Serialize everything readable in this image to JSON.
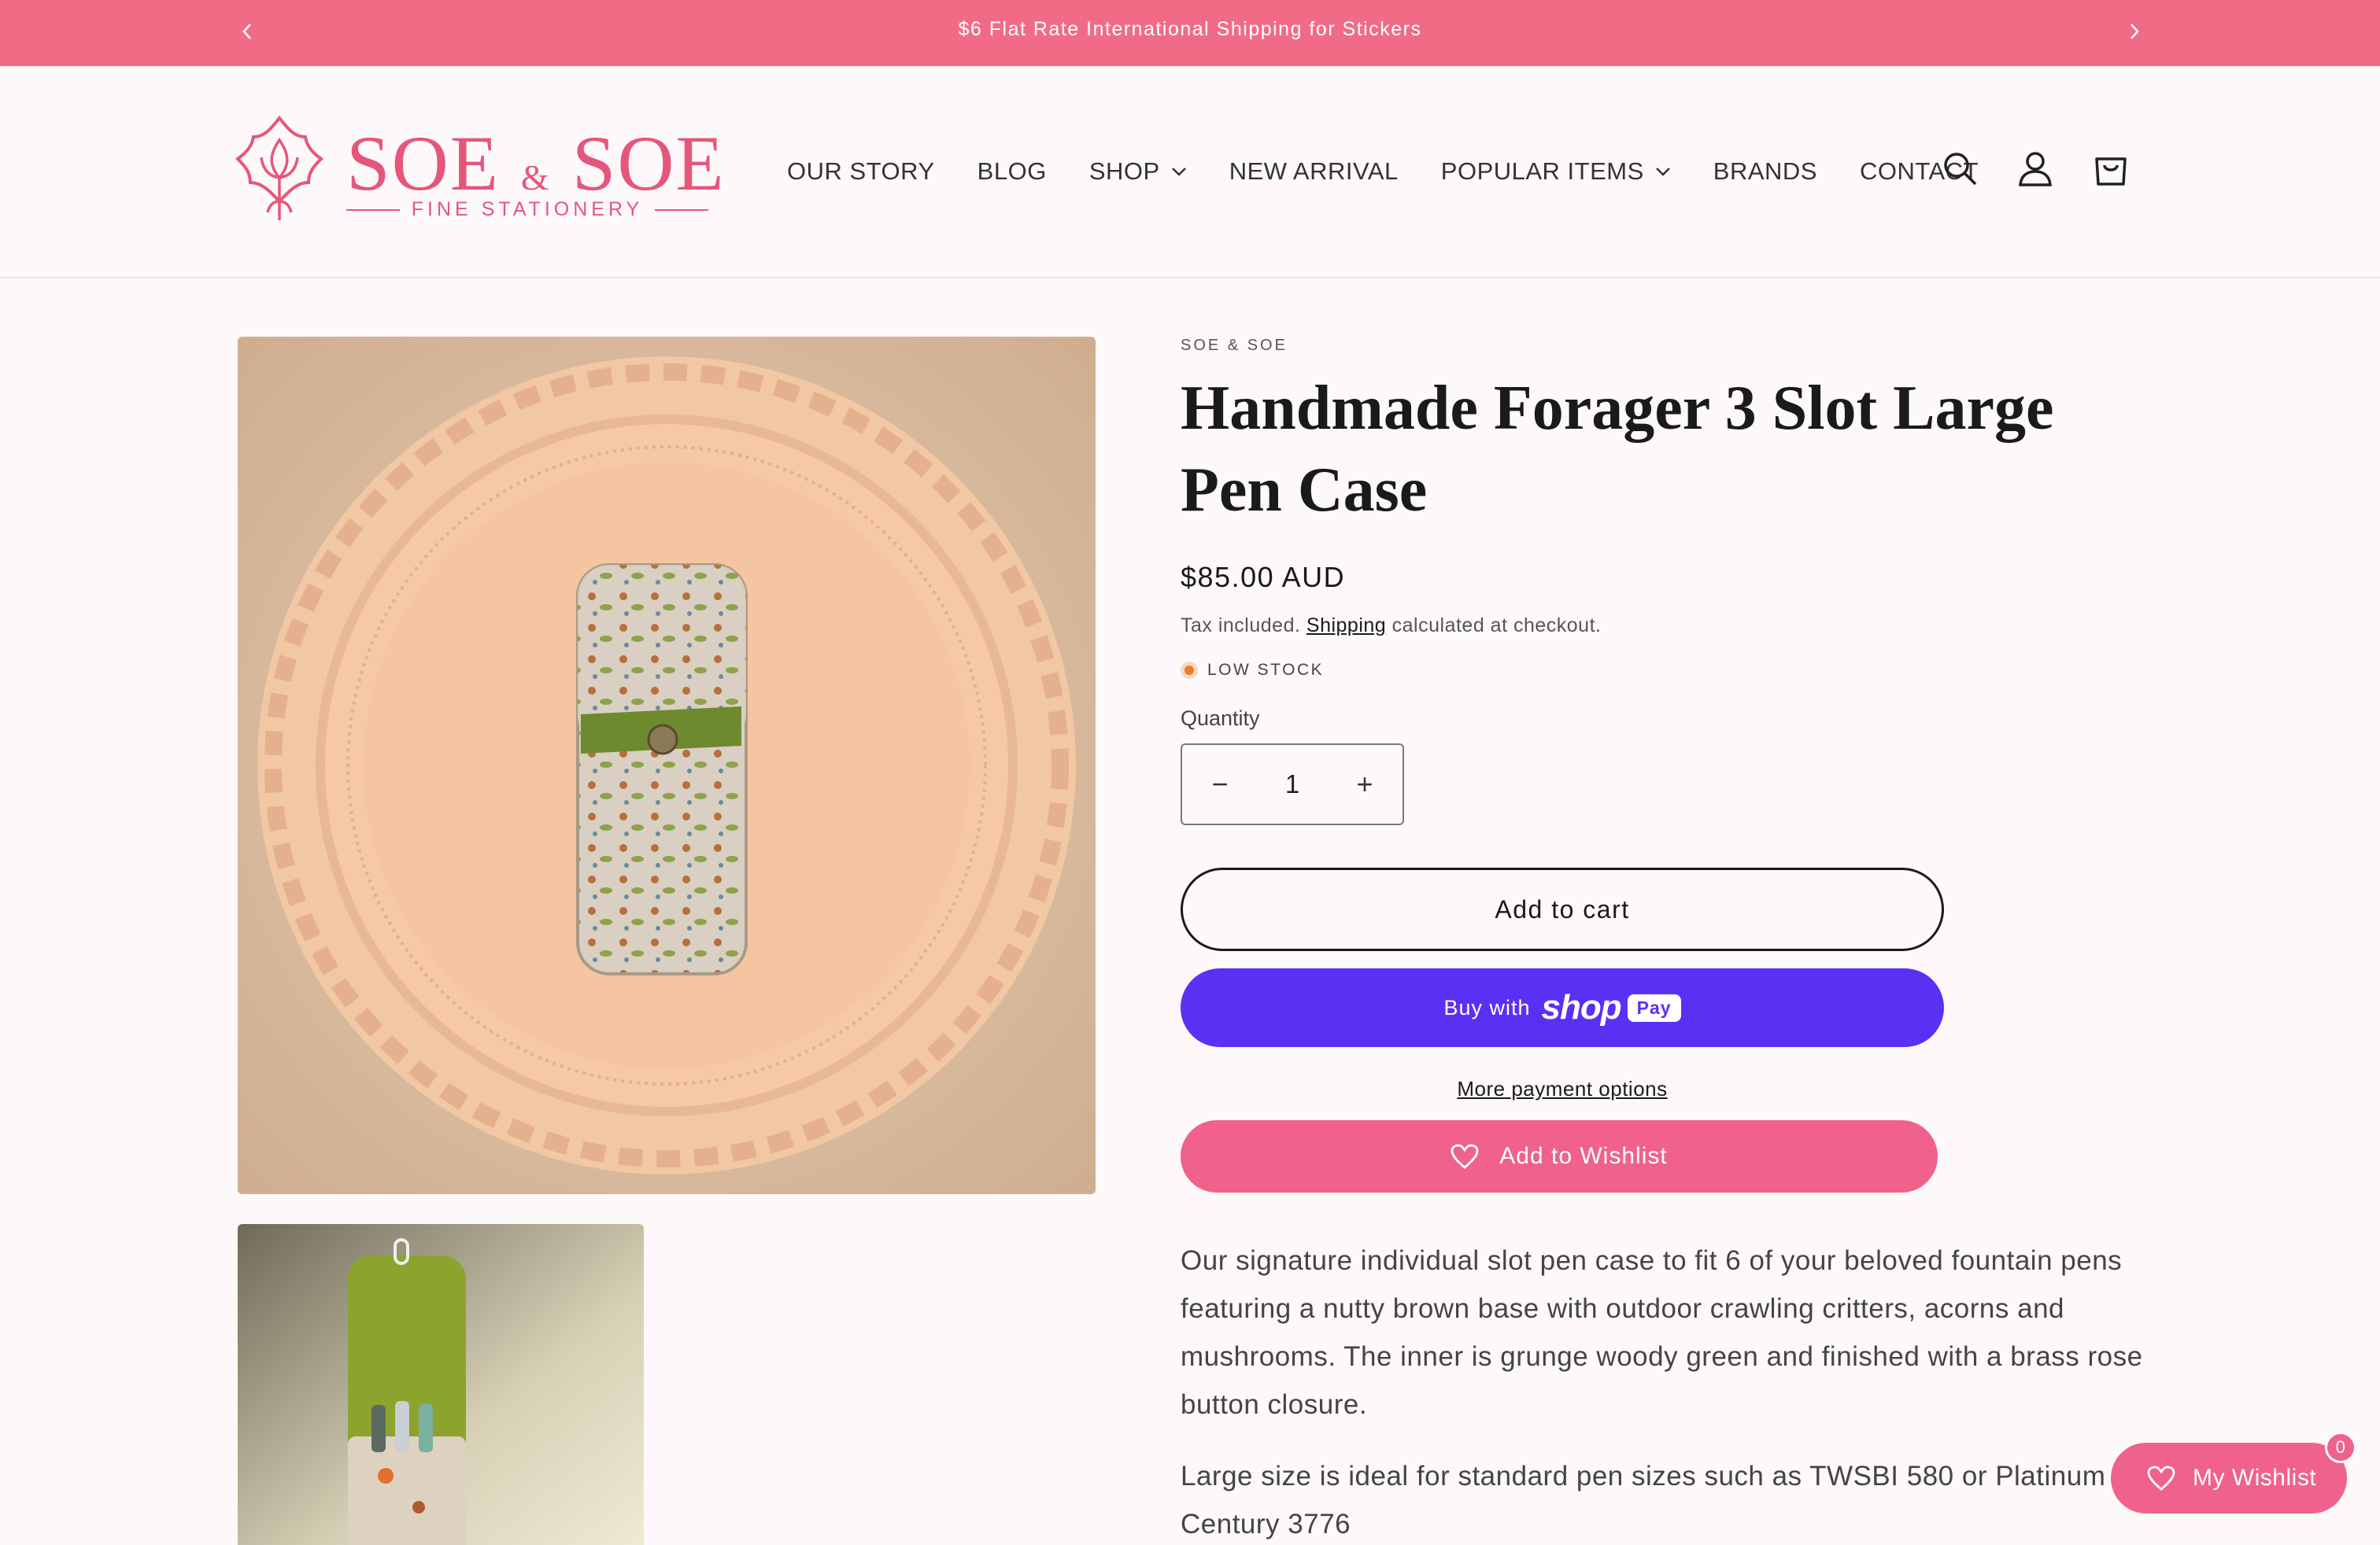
{
  "announcement": {
    "text": "$6 Flat Rate International Shipping for Stickers"
  },
  "logo": {
    "brand_left": "SOE",
    "brand_amp": "&",
    "brand_right": "SOE",
    "subtitle": "FINE STATIONERY"
  },
  "nav": {
    "items": [
      {
        "label": "OUR STORY"
      },
      {
        "label": "BLOG"
      },
      {
        "label": "SHOP"
      },
      {
        "label": "NEW ARRIVAL"
      },
      {
        "label": "POPULAR ITEMS"
      },
      {
        "label": "BRANDS"
      },
      {
        "label": "CONTACT"
      }
    ]
  },
  "product": {
    "vendor": "SOE & SOE",
    "title": "Handmade Forager 3 Slot Large Pen Case",
    "price": "$85.00 AUD",
    "tax_prefix": "Tax included.",
    "tax_link": "Shipping",
    "tax_suffix": "calculated at checkout.",
    "stock": "LOW STOCK",
    "quantity_label": "Quantity",
    "quantity": "1",
    "qty_minus": "−",
    "qty_plus": "+",
    "add_to_cart": "Add to cart",
    "buy_with": "Buy with",
    "shop_logo": "shop",
    "shop_pay": "Pay",
    "more_payment": "More payment options",
    "add_to_wishlist": "Add to Wishlist",
    "description": [
      "Our signature individual slot pen case to fit 6 of your beloved fountain pens featuring a nutty brown base with outdoor crawling critters, acorns and mushrooms. The inner is grunge woody green and finished with a brass rose button closure.",
      "Large size is ideal for standard pen sizes such as TWSBI 580 or Platinum Century 3776"
    ]
  },
  "wishlist_float": {
    "label": "My Wishlist",
    "count": "0"
  },
  "colors": {
    "accent": "#f26b86",
    "wishlist": "#f0628b",
    "shop_pay": "#5a31f4",
    "stock_dot": "#ef7d2a"
  },
  "icons": [
    "chevron-left-icon",
    "chevron-right-icon",
    "chevron-down-icon",
    "search-icon",
    "account-icon",
    "cart-icon",
    "heart-icon",
    "lotus-logo-icon"
  ]
}
